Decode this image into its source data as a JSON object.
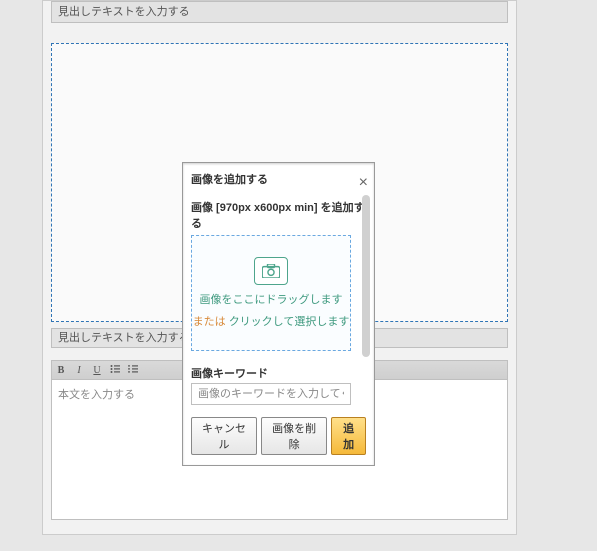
{
  "editor": {
    "heading1_placeholder": "見出しテキストを入力する",
    "heading2_placeholder": "見出しテキストを入力する",
    "body_placeholder": "本文を入力する",
    "toolbar": {
      "b": "B",
      "i": "I",
      "u": "U"
    }
  },
  "modal": {
    "title": "画像を追加する",
    "subheading": "画像 [970px x600px min] を追加する",
    "drop_line1": "画像をここにドラッグします",
    "drop_or": "または ",
    "drop_click": "クリックして選択します",
    "keyword_label": "画像キーワード",
    "keyword_placeholder": "画像のキーワードを入力してください",
    "cancel": "キャンセル",
    "delete": "画像を削除",
    "add": "追加",
    "close": "×"
  }
}
